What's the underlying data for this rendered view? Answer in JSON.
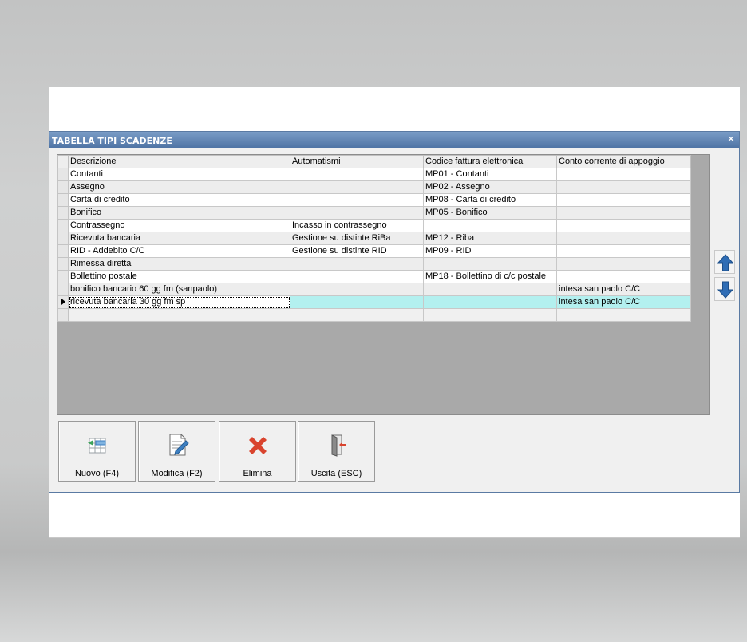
{
  "dialog": {
    "title": "TABELLA TIPI SCADENZE",
    "close_glyph": "×"
  },
  "grid": {
    "columns": [
      "Descrizione",
      "Automatismi",
      "Codice fattura elettronica",
      "Conto corrente di appoggio"
    ],
    "rows": [
      [
        "Contanti",
        "",
        "MP01 - Contanti",
        ""
      ],
      [
        "Assegno",
        "",
        "MP02 - Assegno",
        ""
      ],
      [
        "Carta di credito",
        "",
        "MP08 - Carta di credito",
        ""
      ],
      [
        "Bonifico",
        "",
        "MP05 - Bonifico",
        ""
      ],
      [
        "Contrassegno",
        "Incasso in contrassegno",
        "",
        ""
      ],
      [
        "Ricevuta bancaria",
        "Gestione su distinte RiBa",
        "MP12 - Riba",
        ""
      ],
      [
        "RID - Addebito C/C",
        "Gestione su distinte RID",
        "MP09 - RID",
        ""
      ],
      [
        "Rimessa diretta",
        "",
        "",
        ""
      ],
      [
        "Bollettino postale",
        "",
        "MP18 - Bollettino di c/c postale",
        ""
      ],
      [
        "bonifico bancario 60 gg fm (sanpaolo)",
        "",
        "",
        "intesa san paolo C/C"
      ],
      [
        "ricevuta bancaria 30 gg fm sp",
        "",
        "",
        "intesa san paolo C/C"
      ]
    ],
    "selected_row": 10
  },
  "side_buttons": {
    "up_icon": "arrow-up-icon",
    "down_icon": "arrow-down-icon"
  },
  "buttons": {
    "new": "Nuovo (F4)",
    "edit": "Modifica (F2)",
    "delete": "Elimina",
    "exit": "Uscita (ESC)"
  },
  "colors": {
    "title_bar": "#4f74a5",
    "selected_row": "#b3f0ef",
    "grid_background": "#a9a9a9",
    "arrow_blue": "#2f6db5",
    "delete_red": "#d9442e"
  }
}
